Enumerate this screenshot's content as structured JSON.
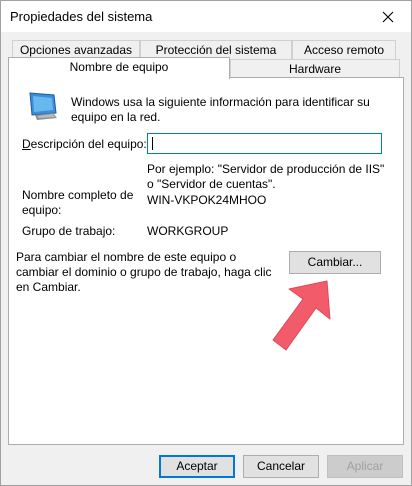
{
  "window": {
    "title": "Propiedades del sistema",
    "close_glyph": "✕"
  },
  "tabs": {
    "row1": [
      {
        "label": "Opciones avanzadas"
      },
      {
        "label": "Protección del sistema"
      },
      {
        "label": "Acceso remoto"
      }
    ],
    "row2": [
      {
        "label": "Nombre de equipo",
        "active": true
      },
      {
        "label": "Hardware"
      }
    ]
  },
  "content": {
    "intro": "Windows usa la siguiente información para identificar su equipo en la red.",
    "description_label": "Descripción del equipo:",
    "description_value": "",
    "example": "Por ejemplo: \"Servidor de producción de IIS\" o \"Servidor de cuentas\".",
    "fullname_label": "Nombre completo de equipo:",
    "fullname_value": "WIN-VKPOK24MHOO",
    "workgroup_label": "Grupo de trabajo:",
    "workgroup_value": "WORKGROUP",
    "change_text": "Para cambiar el nombre de este equipo o cambiar el dominio o grupo de trabajo, haga clic en Cambiar.",
    "change_button": "Cambiar..."
  },
  "footer": {
    "accept": "Aceptar",
    "cancel": "Cancelar",
    "apply": "Aplicar"
  },
  "colors": {
    "accent": "#0078d7",
    "arrow": "#f25c6a"
  },
  "icons": [
    "computer-monitor-icon",
    "close-icon",
    "red-pointer-arrow"
  ]
}
